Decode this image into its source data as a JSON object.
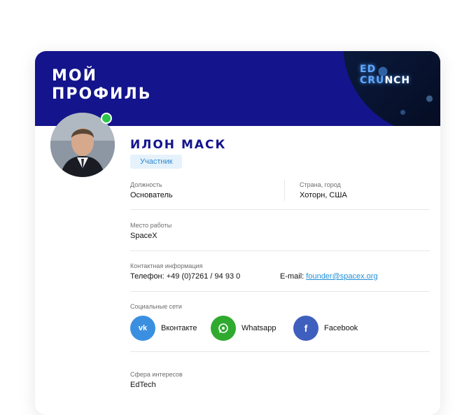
{
  "header": {
    "title": "МОЙ\nПРОФИЛЬ",
    "banner_logo_line1": "ED",
    "banner_logo_line2": "CRU",
    "banner_logo_line2b": "NCH"
  },
  "profile": {
    "name": "ИЛОН МАСК",
    "role": "Участник",
    "online": true
  },
  "fields": {
    "position_label": "Должность",
    "position_value": "Основатель",
    "location_label": "Страна, город",
    "location_value": "Хоторн, США",
    "workplace_label": "Место работы",
    "workplace_value": "SpaceX",
    "contact_label": "Контактная информация",
    "phone_text": "Телефон: +49 (0)7261 / 94 93 0",
    "email_prefix": "E-mail: ",
    "email_value": "founder@spacex.org",
    "social_label": "Социальные сети",
    "interests_label": "Сфера интересов",
    "interests_value": "EdTech"
  },
  "social": [
    {
      "label": "Вконтакте",
      "icon_text": "vk",
      "color": "#3b8fe0"
    },
    {
      "label": "Whatsapp",
      "icon_text": "",
      "color": "#2faa2f"
    },
    {
      "label": "Facebook",
      "icon_text": "f",
      "color": "#3f5fbf"
    }
  ],
  "colors": {
    "header_bg": "#14148c",
    "accent_text": "#14148c",
    "badge_bg": "#e5f2fb",
    "badge_text": "#2b88d0",
    "online": "#2cc64a",
    "link": "#1f8fd6"
  }
}
